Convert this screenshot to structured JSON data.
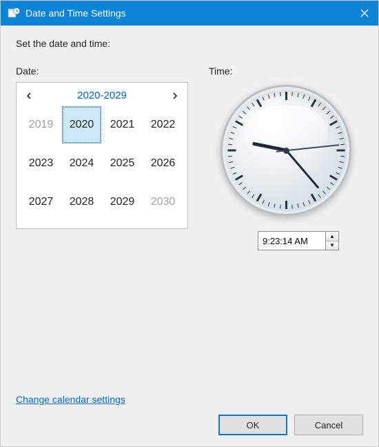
{
  "window": {
    "title": "Date and Time Settings",
    "heading": "Set the date and time:"
  },
  "date_section": {
    "label": "Date:",
    "range_label": "2020-2029",
    "years": [
      {
        "label": "2019",
        "out": true,
        "selected": false
      },
      {
        "label": "2020",
        "out": false,
        "selected": true
      },
      {
        "label": "2021",
        "out": false,
        "selected": false
      },
      {
        "label": "2022",
        "out": false,
        "selected": false
      },
      {
        "label": "2023",
        "out": false,
        "selected": false
      },
      {
        "label": "2024",
        "out": false,
        "selected": false
      },
      {
        "label": "2025",
        "out": false,
        "selected": false
      },
      {
        "label": "2026",
        "out": false,
        "selected": false
      },
      {
        "label": "2027",
        "out": false,
        "selected": false
      },
      {
        "label": "2028",
        "out": false,
        "selected": false
      },
      {
        "label": "2029",
        "out": false,
        "selected": false
      },
      {
        "label": "2030",
        "out": true,
        "selected": false
      }
    ]
  },
  "time_section": {
    "label": "Time:",
    "value": "9:23:14 AM",
    "clock": {
      "hours": 9,
      "minutes": 23,
      "seconds": 14
    }
  },
  "link": {
    "label": "Change calendar settings"
  },
  "footer": {
    "ok_label": "OK",
    "cancel_label": "Cancel"
  }
}
